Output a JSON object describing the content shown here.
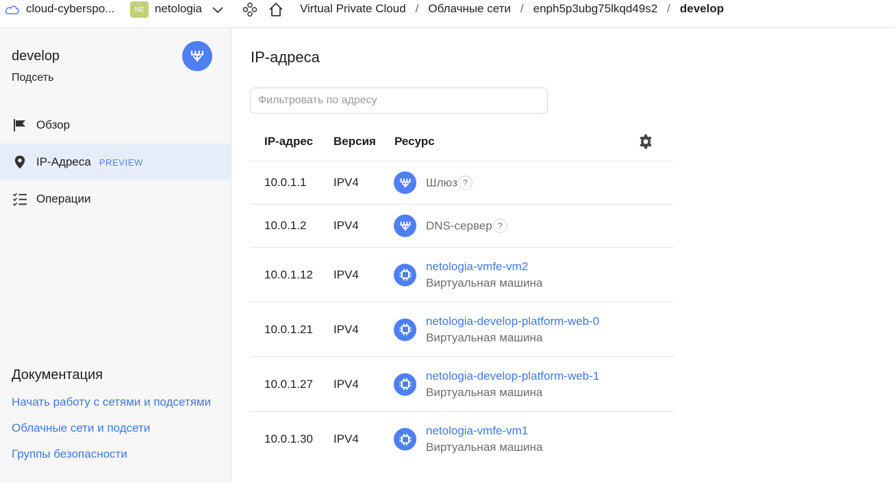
{
  "topbar": {
    "cloud_name": "cloud-cyberspo...",
    "folder_badge": "NE",
    "folder_name": "netologia",
    "breadcrumbs": [
      "Virtual Private Cloud",
      "Облачные сети",
      "enph5p3ubg75lkqd49s2",
      "develop"
    ],
    "separator": "/"
  },
  "sidebar": {
    "title": "develop",
    "subtitle": "Подсеть",
    "nav": [
      {
        "label": "Обзор",
        "icon": "flag-icon"
      },
      {
        "label": "IP-Адреса",
        "icon": "location-pin-icon",
        "badge": "PREVIEW",
        "active": true
      },
      {
        "label": "Операции",
        "icon": "checklist-icon"
      }
    ],
    "docs_title": "Документация",
    "docs_links": [
      "Начать работу с сетями и подсетями",
      "Облачные сети и подсети",
      "Группы безопасности"
    ]
  },
  "main": {
    "title": "IP-адреса",
    "filter_placeholder": "Фильтровать по адресу",
    "columns": [
      "IP-адрес",
      "Версия",
      "Ресурс"
    ],
    "rows": [
      {
        "ip": "10.0.1.1",
        "version": "IPV4",
        "resource": "Шлюз",
        "resource_type": "",
        "icon": "gateway-icon",
        "help": "?"
      },
      {
        "ip": "10.0.1.2",
        "version": "IPV4",
        "resource": "DNS-сервер",
        "resource_type": "",
        "icon": "gateway-icon",
        "help": "?"
      },
      {
        "ip": "10.0.1.12",
        "version": "IPV4",
        "resource": "netologia-vmfe-vm2",
        "resource_type": "Виртуальная машина",
        "icon": "vm-chip-icon"
      },
      {
        "ip": "10.0.1.21",
        "version": "IPV4",
        "resource": "netologia-develop-platform-web-0",
        "resource_type": "Виртуальная машина",
        "icon": "vm-chip-icon"
      },
      {
        "ip": "10.0.1.27",
        "version": "IPV4",
        "resource": "netologia-develop-platform-web-1",
        "resource_type": "Виртуальная машина",
        "icon": "vm-chip-icon"
      },
      {
        "ip": "10.0.1.30",
        "version": "IPV4",
        "resource": "netologia-vmfe-vm1",
        "resource_type": "Виртуальная машина",
        "icon": "vm-chip-icon"
      }
    ]
  },
  "colors": {
    "accent": "#4f7ff5",
    "link": "#3f78e0",
    "badge": "#c3cf7b",
    "active_nav_bg": "#e7edf8",
    "sidebar_bg": "#f7f7f7"
  }
}
